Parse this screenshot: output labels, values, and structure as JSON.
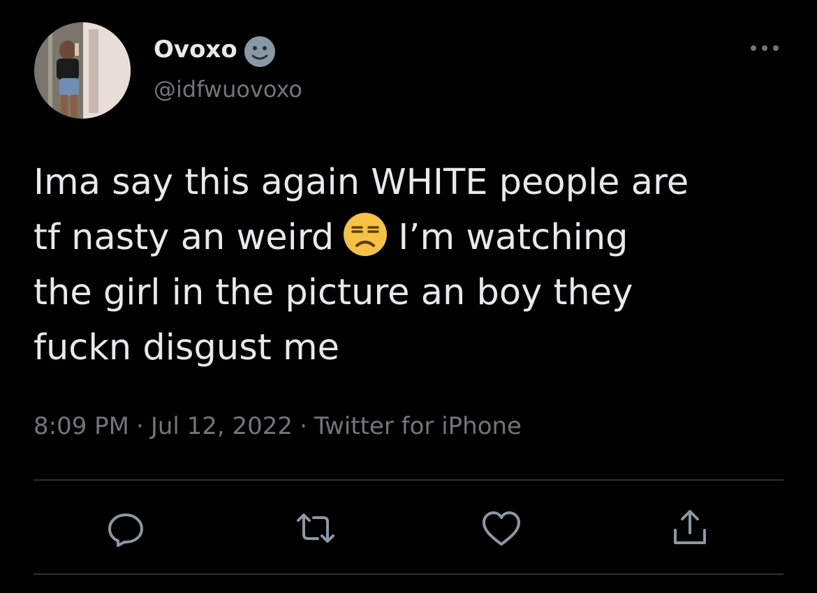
{
  "author": {
    "display_name": "Ovoxo",
    "badge_emoji": "slightly-smiling-face-emoji",
    "handle": "@idfwuovoxo",
    "avatar": "profile-photo"
  },
  "tweet": {
    "lines": [
      "Ima say this again WHITE people are",
      "tf nasty an weird",
      "I’m watching",
      "the girl in the picture an boy they",
      "fuckn disgust me"
    ],
    "inline_emoji": "unamused-face-emoji"
  },
  "meta": {
    "time": "8:09 PM",
    "separator": "·",
    "date": "Jul 12, 2022",
    "source": "Twitter for iPhone"
  },
  "actions": {
    "icons": [
      "reply-icon",
      "retweet-icon",
      "like-icon",
      "share-icon"
    ]
  },
  "colors": {
    "background": "#000000",
    "text": "#e7e9ea",
    "secondary_text": "#71767b",
    "divider": "#2f3336",
    "emoji_yellow": "#f5c243"
  }
}
